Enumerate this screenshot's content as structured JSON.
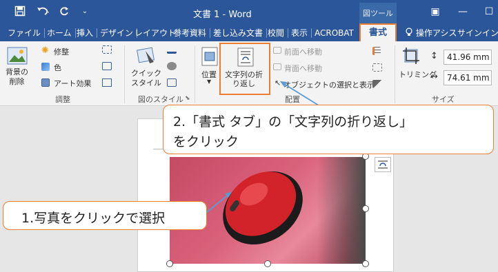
{
  "title_bar": {
    "doc_title": "文書 1 - Word",
    "context_label": "図ツール"
  },
  "tabs": [
    "ファイル",
    "ホーム",
    "挿入",
    "デザイン",
    "レイアウト",
    "参考資料",
    "差し込み文書",
    "校閲",
    "表示",
    "ACROBAT"
  ],
  "active_tab": "書式",
  "tell_me": "操作アシス",
  "signin": "サインイン",
  "ribbon": {
    "adjust": {
      "remove_bg": "背景の\n削除",
      "corrections": "修整",
      "color": "色",
      "artistic": "アート効果",
      "group": "調整"
    },
    "styles": {
      "quick_style": "クイック\nスタイル",
      "group": "図のスタイル"
    },
    "arrange": {
      "position": "位置",
      "wrap_text": "文字列の折\nり返し",
      "bring_forward": "前面へ移動",
      "send_backward": "背面へ移動",
      "selection_pane": "オブジェクトの選択と表示",
      "group": "配置"
    },
    "size": {
      "crop": "トリミング",
      "height": "41.96 mm",
      "width": "74.61 mm",
      "group": "サイズ"
    }
  },
  "callouts": {
    "step1": "1.写真をクリックで選択",
    "step2_line1": "2.「書式 タブ」の「文字列の折り返し」",
    "step2_line2": "をクリック"
  },
  "colors": {
    "title_bar": "#2b579a",
    "highlight": "#ed7d31",
    "arrow": "#5b9bd5"
  }
}
